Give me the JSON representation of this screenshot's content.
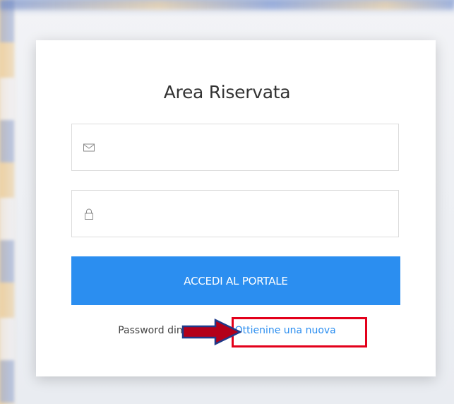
{
  "login": {
    "title": "Area Riservata",
    "email": {
      "value": "",
      "icon": "envelope-icon"
    },
    "password": {
      "value": "",
      "icon": "lock-icon"
    },
    "submit_label": "ACCEDI AL PORTALE",
    "forgot_prefix": "Password dimenticata?",
    "forgot_link": "Ottienine una nuova"
  },
  "annotations": {
    "highlight_color": "#e3001b",
    "arrow_fill": "#b3001a",
    "arrow_stroke": "#1f3a8a"
  },
  "colors": {
    "primary": "#2b8ef0",
    "title_text": "#333333",
    "border": "#dcdcdc"
  }
}
